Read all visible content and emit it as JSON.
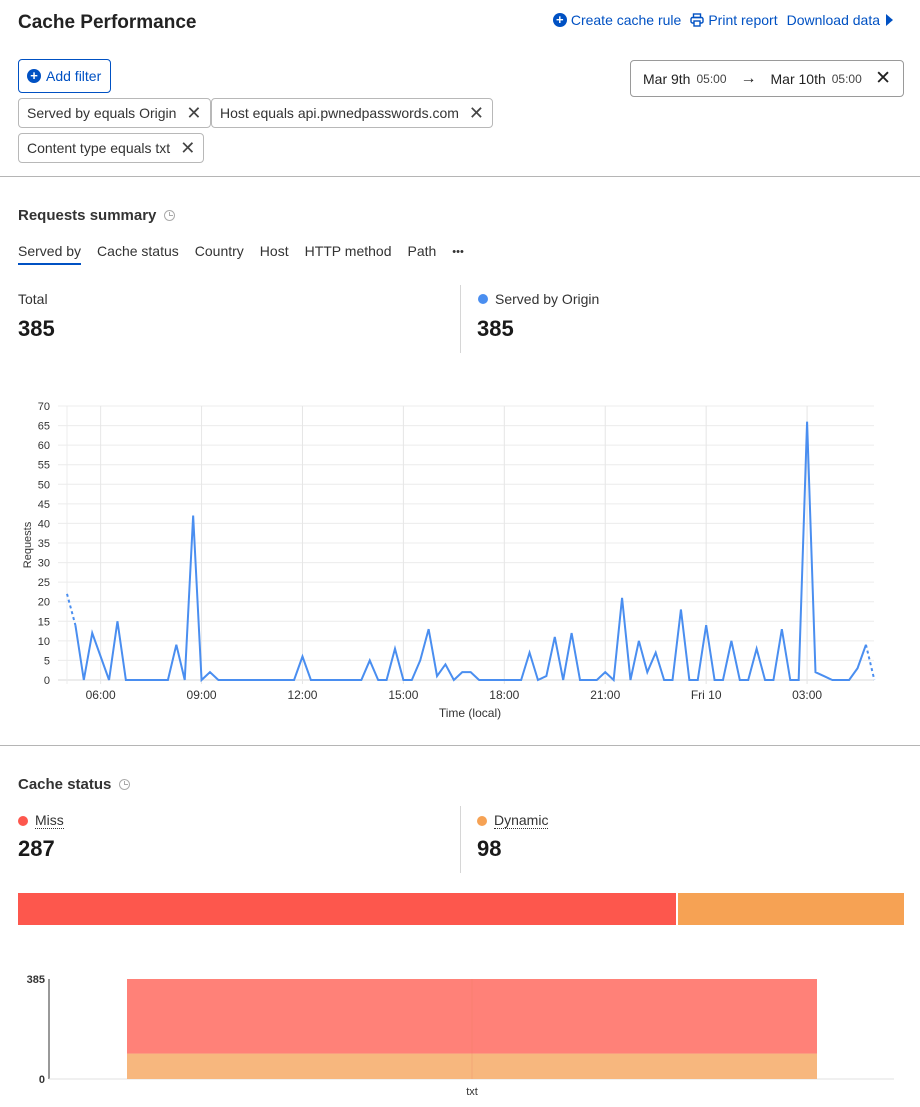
{
  "header": {
    "title": "Cache Performance",
    "actions": [
      {
        "label": "Create cache rule",
        "icon": "plus-circle-icon"
      },
      {
        "label": "Print report",
        "icon": "printer-icon"
      },
      {
        "label": "Download data",
        "icon": "caret-right-icon"
      }
    ]
  },
  "filters": {
    "add_label": "Add filter",
    "chips": [
      "Served by equals Origin",
      "Host equals api.pwnedpasswords.com",
      "Content type equals txt"
    ]
  },
  "date_range": {
    "start_date": "Mar 9th",
    "start_time": "05:00",
    "end_date": "Mar 10th",
    "end_time": "05:00"
  },
  "requests_summary": {
    "title": "Requests summary",
    "tabs": [
      "Served by",
      "Cache status",
      "Country",
      "Host",
      "HTTP method",
      "Path"
    ],
    "active_tab": "Served by",
    "more_label": "•••",
    "total_label": "Total",
    "total_value": "385",
    "series_label": "Served by Origin",
    "series_value": "385",
    "series_color": "#4a8ef0"
  },
  "chart_data": [
    {
      "type": "line",
      "title": "",
      "xlabel": "Time (local)",
      "ylabel": "Requests",
      "ylim": [
        0,
        70
      ],
      "yticks": [
        0,
        5,
        10,
        15,
        20,
        25,
        30,
        35,
        40,
        45,
        50,
        55,
        60,
        65,
        70
      ],
      "xtick_labels": [
        "06:00",
        "09:00",
        "12:00",
        "15:00",
        "18:00",
        "21:00",
        "Fri 10",
        "03:00"
      ],
      "x_interval": "15 minutes",
      "x_start": "Mar 9 05:00",
      "x_end": "Mar 10 05:00",
      "grid": true,
      "series": [
        {
          "name": "Served by Origin",
          "color": "#4a8ef0",
          "values": [
            22,
            14,
            0,
            12,
            6,
            0,
            15,
            0,
            0,
            0,
            0,
            0,
            0,
            9,
            0,
            42,
            0,
            2,
            0,
            0,
            0,
            0,
            0,
            0,
            0,
            0,
            0,
            0,
            6,
            0,
            0,
            0,
            0,
            0,
            0,
            0,
            5,
            0,
            0,
            8,
            0,
            0,
            5,
            13,
            1,
            4,
            0,
            2,
            2,
            0,
            0,
            0,
            0,
            0,
            0,
            7,
            0,
            1,
            11,
            0,
            12,
            0,
            0,
            0,
            2,
            0,
            21,
            0,
            10,
            2,
            7,
            0,
            0,
            18,
            0,
            0,
            14,
            0,
            0,
            10,
            0,
            0,
            8,
            0,
            0,
            13,
            0,
            0,
            66,
            2,
            1,
            0,
            0,
            0,
            3,
            9,
            0
          ]
        }
      ]
    },
    {
      "type": "bar",
      "stacked": true,
      "categories": [
        "txt"
      ],
      "ytick_labels": [
        "0",
        "385"
      ],
      "ylim": [
        0,
        385
      ],
      "series": [
        {
          "name": "Dynamic",
          "values": [
            98
          ],
          "color": "#f7b77e"
        },
        {
          "name": "Miss",
          "values": [
            287
          ],
          "color": "#ff8178"
        }
      ]
    }
  ],
  "cache_status": {
    "title": "Cache status",
    "items": [
      {
        "label": "Miss",
        "value": "287",
        "count": 287,
        "color": "#fd574d"
      },
      {
        "label": "Dynamic",
        "value": "98",
        "count": 98,
        "color": "#f6a254"
      }
    ]
  }
}
